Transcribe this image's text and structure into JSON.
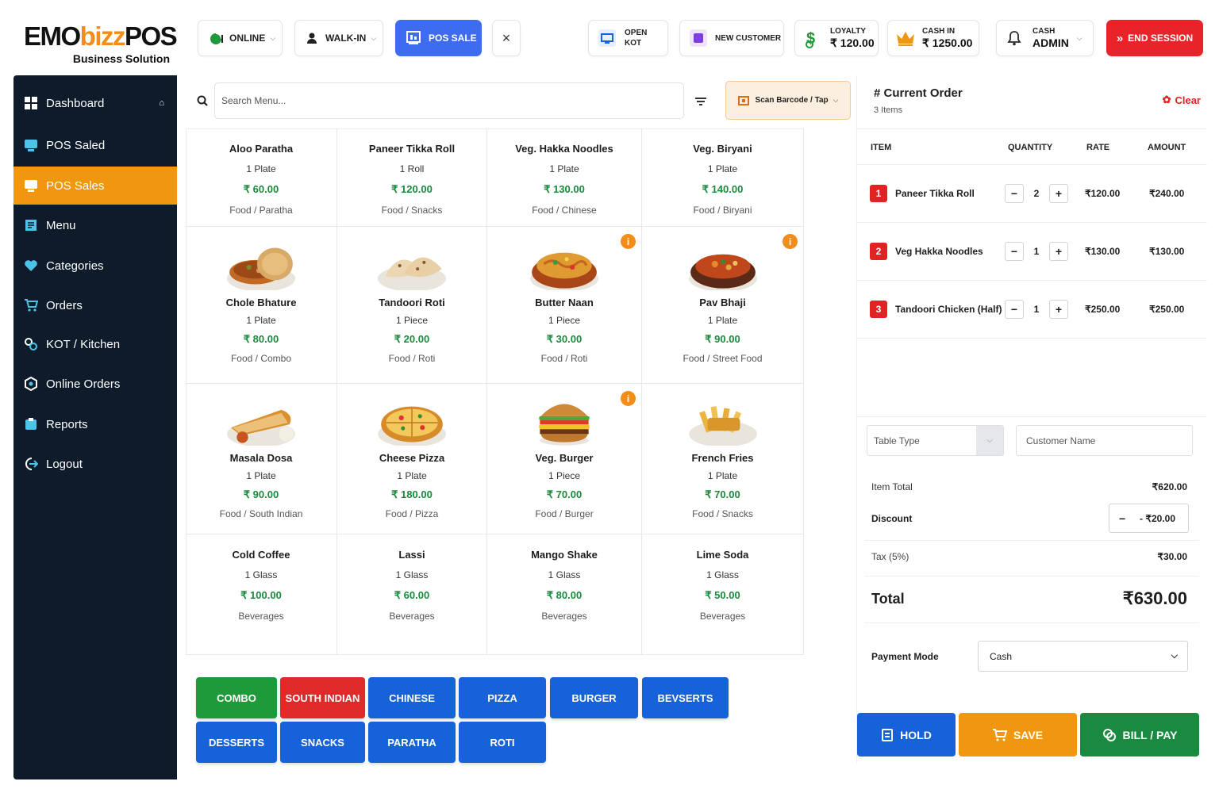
{
  "brand": {
    "part1": "EMO",
    "part2": "bizz",
    "part3": "POS",
    "tagline": "Business Solution"
  },
  "topbar": {
    "online": "ONLINE",
    "walkin": "WALK-IN",
    "pos_sale": "POS SALE",
    "close": "×",
    "open_kot_1": "OPEN",
    "open_kot_2": "KOT",
    "new_customer": "NEW CUSTOMER",
    "loyalty_label": "LOYALTY",
    "loyalty_value": "₹ 120.00",
    "cashin_label": "CASH IN",
    "cashin_value": "₹ 1250.00",
    "user_label": "CASH",
    "user_value": "ADMIN",
    "end_session": "END SESSION"
  },
  "sidebar": {
    "items": [
      {
        "label": "Dashboard",
        "icon": "dashboard-icon"
      },
      {
        "label": "POS Saled",
        "icon": "pos-icon"
      },
      {
        "label": "POS Sales",
        "icon": "pos-sales-icon",
        "active": true
      },
      {
        "label": "Menu",
        "icon": "menu-icon"
      },
      {
        "label": "Categories",
        "icon": "categories-icon"
      },
      {
        "label": "Orders",
        "icon": "cart-icon"
      },
      {
        "label": "KOT / Kitchen",
        "icon": "kitchen-icon"
      },
      {
        "label": "Online Orders",
        "icon": "online-orders-icon"
      },
      {
        "label": "Reports",
        "icon": "reports-icon"
      },
      {
        "label": "Logout",
        "icon": "logout-icon"
      }
    ]
  },
  "search": {
    "placeholder": "Search Menu...",
    "scan_label": "Scan Barcode / Tap"
  },
  "menu_items": [
    {
      "name": "Aloo Paratha",
      "unit": "1 Plate",
      "price": "₹ 60.00",
      "category": "Food / Paratha"
    },
    {
      "name": "Paneer Tikka Roll",
      "unit": "1 Roll",
      "price": "₹ 120.00",
      "category": "Food / Snacks"
    },
    {
      "name": "Veg. Hakka Noodles",
      "unit": "1 Plate",
      "price": "₹ 130.00",
      "category": "Food / Chinese"
    },
    {
      "name": "Veg. Biryani",
      "unit": "1 Plate",
      "price": "₹ 140.00",
      "category": "Food / Biryani"
    },
    {
      "name": "Chole Bhature",
      "unit": "1 Plate",
      "price": "₹ 80.00",
      "category": "Food / Combo",
      "image": "paratha-curry"
    },
    {
      "name": "Tandoori Roti",
      "unit": "1 Piece",
      "price": "₹ 20.00",
      "category": "Food / Roti",
      "image": "roti"
    },
    {
      "name": "Butter Naan",
      "unit": "1 Piece",
      "price": "₹ 30.00",
      "category": "Food / Roti",
      "image": "noodles",
      "info": true
    },
    {
      "name": "Pav Bhaji",
      "unit": "1 Plate",
      "price": "₹ 90.00",
      "category": "Food / Street Food",
      "image": "curry",
      "info": true
    },
    {
      "name": "Masala Dosa",
      "unit": "1 Plate",
      "price": "₹ 90.00",
      "category": "Food / South Indian",
      "image": "dosa"
    },
    {
      "name": "Cheese Pizza",
      "unit": "1 Plate",
      "price": "₹ 180.00",
      "category": "Food / Pizza",
      "image": "pizza"
    },
    {
      "name": "Veg. Burger",
      "unit": "1 Piece",
      "price": "₹ 70.00",
      "category": "Food / Burger",
      "image": "burger",
      "info": true
    },
    {
      "name": "French Fries",
      "unit": "1 Plate",
      "price": "₹ 70.00",
      "category": "Food / Snacks",
      "image": "fries"
    },
    {
      "name": "Cold Coffee",
      "unit": "1 Glass",
      "price": "₹ 100.00",
      "category": "Beverages"
    },
    {
      "name": "Lassi",
      "unit": "1 Glass",
      "price": "₹ 60.00",
      "category": "Beverages"
    },
    {
      "name": "Mango Shake",
      "unit": "1 Glass",
      "price": "₹ 80.00",
      "category": "Beverages"
    },
    {
      "name": "Lime Soda",
      "unit": "1 Glass",
      "price": "₹ 50.00",
      "category": "Beverages"
    }
  ],
  "categories": [
    {
      "label": "COMBO",
      "color": "#1f9a3a"
    },
    {
      "label": "SOUTH INDIAN",
      "color": "#e02a2a"
    },
    {
      "label": "CHINESE",
      "color": "#1662d8"
    },
    {
      "label": "PIZZA",
      "color": "#1662d8"
    },
    {
      "label": "BURGER",
      "color": "#1662d8"
    },
    {
      "label": "BEVSERTS",
      "color": "#1662d8"
    },
    {
      "label": "DESSERTS",
      "color": "#1662d8"
    },
    {
      "label": "SNACKS",
      "color": "#1662d8"
    },
    {
      "label": "PARATHA",
      "color": "#1662d8"
    },
    {
      "label": "ROTI",
      "color": "#1662d8"
    }
  ],
  "order": {
    "title": "# Current Order",
    "count": "3 Items",
    "clear": "Clear",
    "headers": {
      "item": "ITEM",
      "qty": "QUANTITY",
      "rate": "RATE",
      "amount": "AMOUNT"
    },
    "items": [
      {
        "no": "1",
        "name": "Paneer Tikka Roll",
        "qty": "2",
        "rate": "₹120.00",
        "amount": "₹240.00"
      },
      {
        "no": "2",
        "name": "Veg Hakka Noodles",
        "qty": "1",
        "rate": "₹130.00",
        "amount": "₹130.00"
      },
      {
        "no": "3",
        "name": "Tandoori Chicken (Half)",
        "qty": "1",
        "rate": "₹250.00",
        "amount": "₹250.00"
      }
    ],
    "table_type_placeholder": "Table Type",
    "customer_placeholder": "Customer Name",
    "item_total_label": "Item Total",
    "item_total": "₹620.00",
    "discount_label": "Discount",
    "discount": "- ₹20.00",
    "tax_label": "Tax (5%)",
    "tax": "₹30.00",
    "total_label": "Total",
    "total": "₹630.00",
    "payment_label": "Payment Mode",
    "payment_value": "Cash",
    "hold": "HOLD",
    "save": "SAVE",
    "bill": "BILL / PAY"
  },
  "colors": {
    "accent": "#f0960f",
    "sidebar": "#0e1b2b",
    "blue": "#1662d8",
    "green": "#1f9a3a",
    "red": "#e02a2a",
    "price": "#198a3c"
  }
}
